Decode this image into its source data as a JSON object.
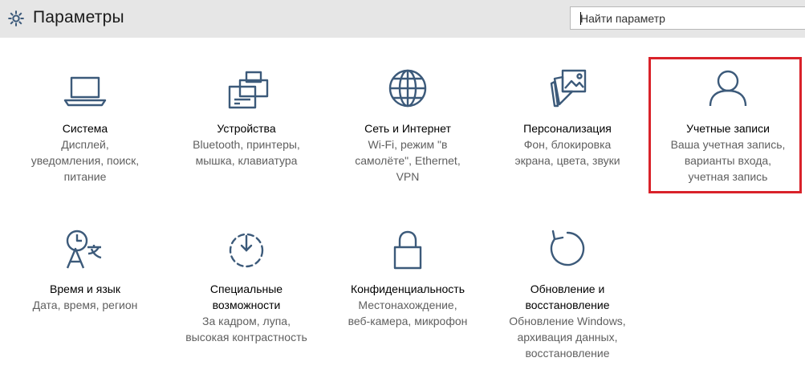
{
  "window": {
    "title": "Параметры"
  },
  "search": {
    "placeholder": "Найти параметр"
  },
  "tiles": [
    {
      "title": "Система",
      "desc": "Дисплей,\nуведомления, поиск,\nпитание"
    },
    {
      "title": "Устройства",
      "desc": "Bluetooth, принтеры,\nмышка, клавиатура"
    },
    {
      "title": "Сеть и Интернет",
      "desc": "Wi-Fi, режим \"в\nсамолёте\", Ethernet,\nVPN"
    },
    {
      "title": "Персонализация",
      "desc": "Фон, блокировка\nэкрана, цвета, звуки"
    },
    {
      "title": "Учетные записи",
      "desc": "Ваша учетная запись,\nварианты входа,\nучетная запись"
    },
    {
      "title": "Время и язык",
      "desc": "Дата, время, регион"
    },
    {
      "title": "Специальные\nвозможности",
      "desc": "За кадром, лупа,\nвысокая контрастность"
    },
    {
      "title": "Конфиденциальность",
      "desc": "Местонахождение,\nвеб-камера, микрофон"
    },
    {
      "title": "Обновление и\nвосстановление",
      "desc": "Обновление Windows,\nархивация данных,\nвосстановление"
    }
  ],
  "icons": [
    "gear-icon",
    "laptop-icon",
    "devices-icon",
    "globe-icon",
    "personalization-icon",
    "person-icon",
    "time-language-icon",
    "accessibility-icon",
    "lock-icon",
    "update-icon"
  ],
  "colors": {
    "accent_icon": "#3c5a7a",
    "highlight": "#d9222a",
    "titlebar": "#e6e6e6"
  }
}
